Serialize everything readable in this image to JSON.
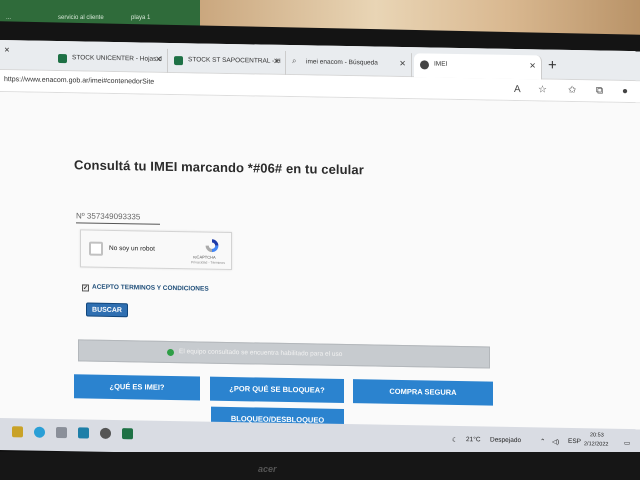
{
  "background": {
    "excel_tabs": [
      "...",
      "servicio al cliente",
      "playa 1"
    ]
  },
  "browser": {
    "tabs": [
      {
        "label": "STOCK UNICENTER - Hojas d",
        "icon": "excel-icon",
        "color": "#1e7145"
      },
      {
        "label": "STOCK ST SAPOCENTRAL - H",
        "icon": "excel-icon",
        "color": "#1e7145"
      },
      {
        "label": "imei enacom - Búsqueda",
        "icon": "search-icon",
        "color": "#555555"
      },
      {
        "label": "IMEI",
        "icon": "site-icon",
        "color": "#444444",
        "active": true
      }
    ],
    "url": "https://www.enacom.gob.ar/imei#contenedorSite"
  },
  "page": {
    "heading": "Consultá tu IMEI marcando *#06# en tu celular",
    "imei_value": "Nº 357349093335",
    "captcha": {
      "label": "No soy un robot",
      "brand": "reCAPTCHA",
      "sub": "Privacidad - Términos"
    },
    "terms_label": "ACEPTO TERMINOS Y CONDICIONES",
    "terms_checked": true,
    "search_button": "BUSCAR",
    "status_message": "El equipo consultado se encuentra habilitado para el uso",
    "buttons": {
      "what_is_imei": "¿QUÉ ES IMEI?",
      "why_blocked": "¿POR QUÉ SE BLOQUEA?",
      "safe_purchase": "COMPRA SEGURA",
      "block_unblock": "BLOQUEO/DESBLOQUEO"
    },
    "accent_color": "#2b83cf",
    "success_color": "#2e9e46"
  },
  "taskbar": {
    "weather_temp": "21°C",
    "weather_text": "Despejado",
    "language": "ESP",
    "time": "20:53",
    "date": "2/12/2022"
  },
  "monitor_brand": "acer"
}
